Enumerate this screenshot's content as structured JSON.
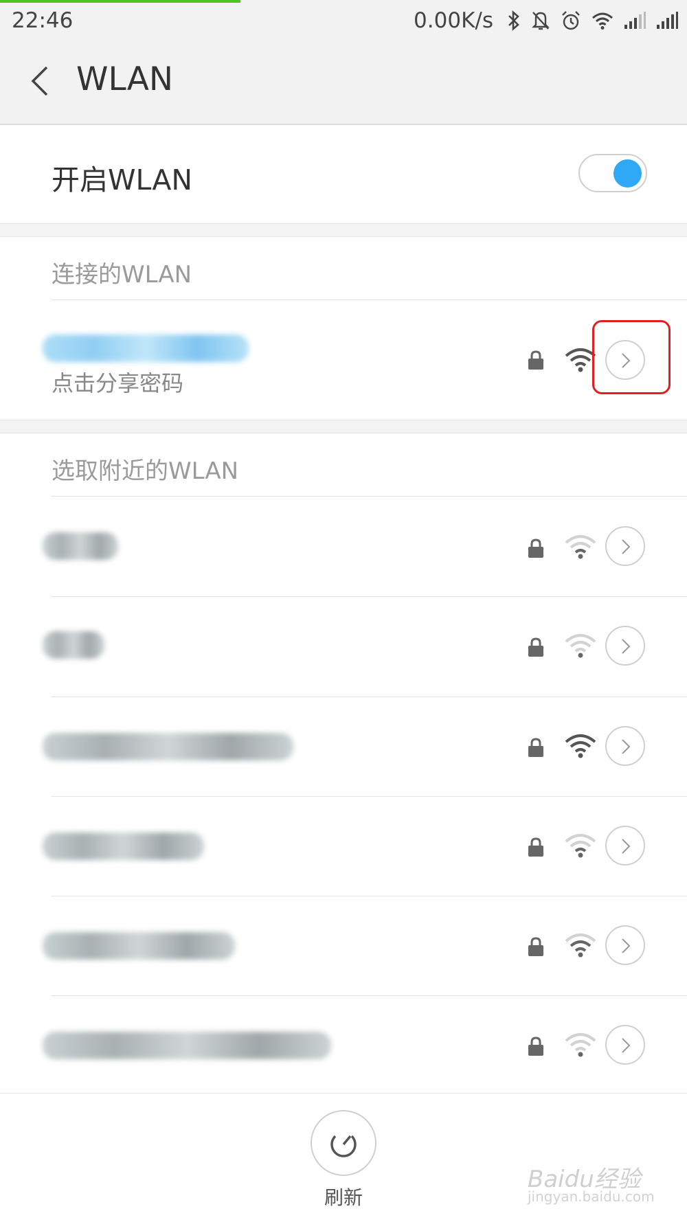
{
  "status_bar": {
    "time": "22:46",
    "net_speed": "0.00K/s",
    "icons": [
      "bluetooth-icon",
      "mute-bell-icon",
      "alarm-icon",
      "wifi-status-icon",
      "signal-icon-1",
      "signal-icon-2"
    ]
  },
  "header": {
    "title": "WLAN"
  },
  "wlan_toggle": {
    "label": "开启WLAN",
    "enabled": true,
    "accent_color": "#2fa9f5"
  },
  "connected_section": {
    "header": "连接的WLAN",
    "network": {
      "name": "",
      "subtitle": "点击分享密码",
      "secured": true,
      "signal": "strong"
    }
  },
  "nearby_section": {
    "header": "选取附近的WLAN",
    "networks": [
      {
        "name": "",
        "secured": true,
        "signal": "weak"
      },
      {
        "name": "",
        "secured": true,
        "signal": "weak"
      },
      {
        "name": "",
        "secured": true,
        "signal": "strong"
      },
      {
        "name": "",
        "secured": true,
        "signal": "weak"
      },
      {
        "name": "",
        "secured": true,
        "signal": "medium"
      },
      {
        "name": "",
        "secured": true,
        "signal": "weak"
      }
    ]
  },
  "bottom_bar": {
    "refresh_label": "刷新"
  },
  "watermark": {
    "brand": "Baidu经验",
    "url": "jingyan.baidu.com"
  }
}
